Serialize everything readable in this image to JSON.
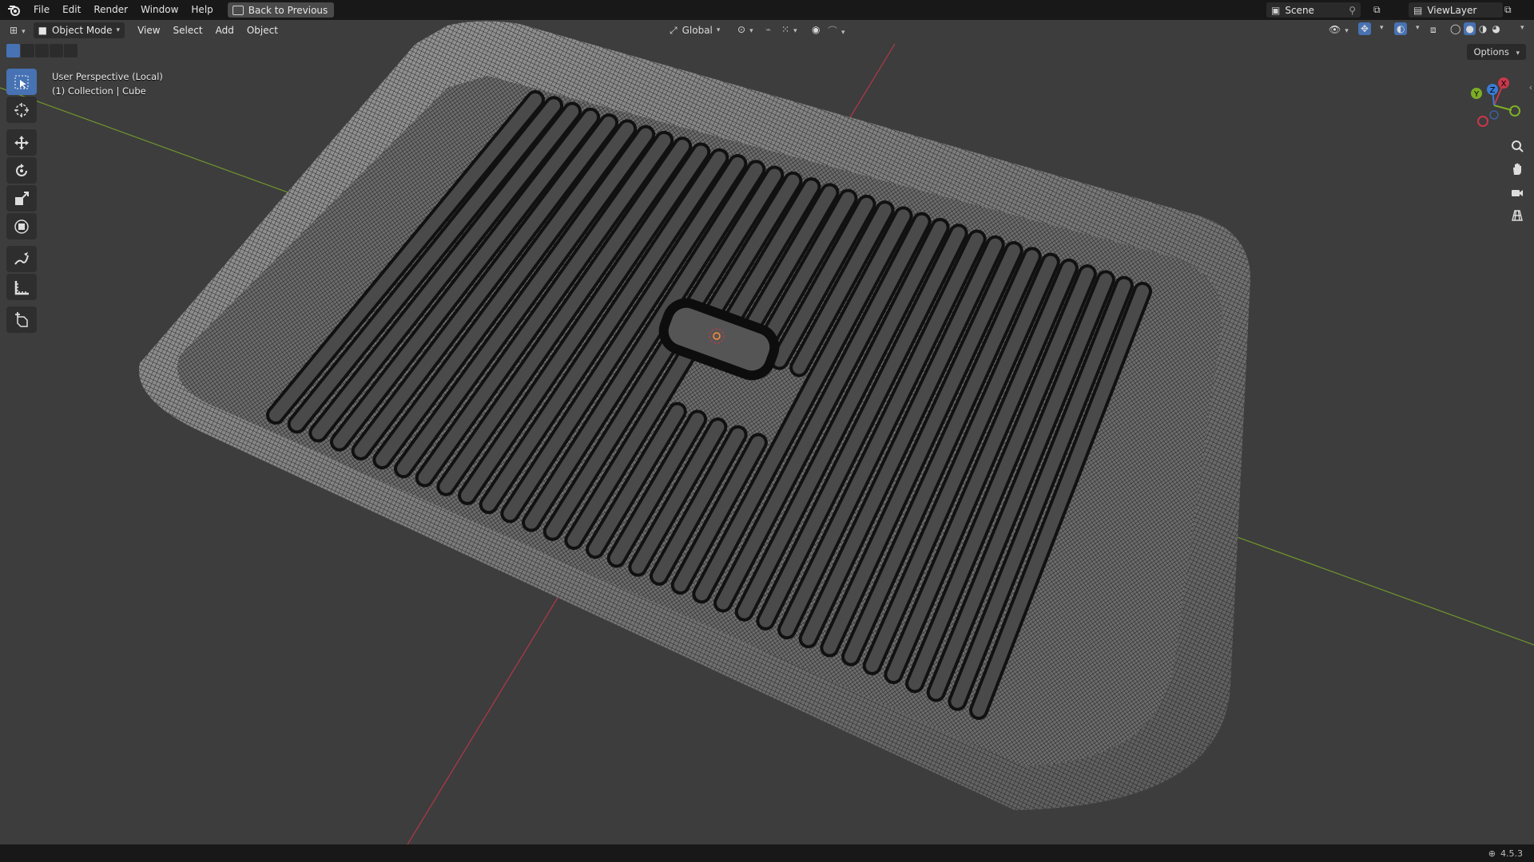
{
  "menu": {
    "items": [
      "File",
      "Edit",
      "Render",
      "Window",
      "Help"
    ],
    "back_button": "Back to Previous"
  },
  "scene": {
    "label": "Scene",
    "view_layer": "ViewLayer"
  },
  "header": {
    "mode": "Object Mode",
    "menus": [
      "View",
      "Select",
      "Add",
      "Object"
    ],
    "orientation": "Global"
  },
  "viewport": {
    "perspective_label": "User Perspective (Local)",
    "collection_label": "(1) Collection | Cube",
    "options_label": "Options",
    "gizmo_axes": {
      "x": "X",
      "y": "Y",
      "z": "Z"
    }
  },
  "status": {
    "version": "4.5.3"
  },
  "colors": {
    "accent": "#4772b3",
    "x_axis": "#c8384b",
    "y_axis": "#7dae28",
    "z_axis": "#3a7bd5"
  }
}
